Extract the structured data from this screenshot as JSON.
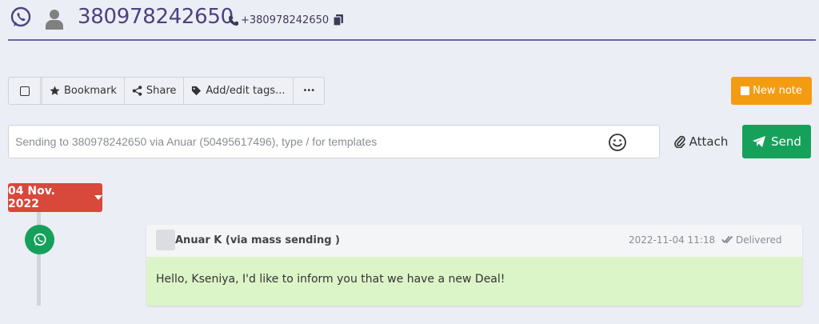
{
  "header": {
    "title": "380978242650",
    "phone": "+380978242650"
  },
  "toolbar": {
    "bookmark_label": "Bookmark",
    "share_label": "Share",
    "tags_label": "Add/edit tags...",
    "more_label": "•••",
    "new_note_label": "New note"
  },
  "composer": {
    "placeholder": "Sending to 380978242650 via Anuar (50495617496), type / for templates",
    "value": "",
    "attach_label": "Attach",
    "send_label": "Send"
  },
  "timeline": {
    "date_label": "04 Nov. 2022",
    "messages": [
      {
        "sender": "Anuar K (via mass sending )",
        "timestamp": "2022-11-04 11:18",
        "status": "Delivered",
        "text": "Hello, Kseniya, I'd like to inform you that we have a new Deal!"
      }
    ]
  },
  "colors": {
    "accent": "#4b4380",
    "whatsapp_green": "#16a15a",
    "note_orange": "#f39c12",
    "date_red": "#d8483b",
    "message_bg": "#dcf5c8"
  },
  "icons": {
    "channel": "whatsapp-icon",
    "contact": "user-icon",
    "phone": "phone-icon",
    "copy": "copy-icon",
    "emoji": "smile-icon",
    "attach": "paperclip-icon",
    "send": "paper-plane-icon",
    "status": "double-check-icon"
  }
}
